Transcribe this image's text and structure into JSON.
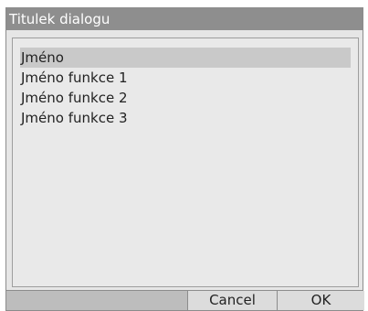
{
  "dialog": {
    "title": "Titulek dialogu",
    "items": [
      {
        "label": "Jméno",
        "selected": true
      },
      {
        "label": "Jméno funkce 1",
        "selected": false
      },
      {
        "label": "Jméno funkce 2",
        "selected": false
      },
      {
        "label": "Jméno funkce 3",
        "selected": false
      }
    ],
    "buttons": {
      "cancel": "Cancel",
      "ok": "OK"
    }
  },
  "colors": {
    "title_bar": "#8e8e8e",
    "dialog_bg": "#e6e6e6",
    "selected_item": "#c9c9c9",
    "button_bar": "#bdbdbd"
  }
}
